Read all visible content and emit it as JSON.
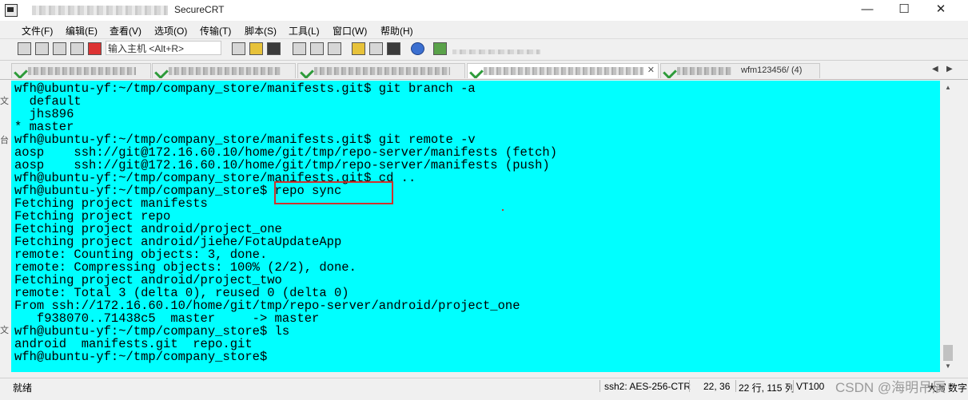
{
  "window": {
    "title": "SecureCRT",
    "controls": {
      "minimize": "—",
      "maximize": "☐",
      "close": "✕"
    }
  },
  "menu": [
    "文件(F)",
    "编辑(E)",
    "查看(V)",
    "选项(O)",
    "传输(T)",
    "脚本(S)",
    "工具(L)",
    "窗口(W)",
    "帮助(H)"
  ],
  "toolbar": {
    "host_input_placeholder": "输入主机 <Alt+R>"
  },
  "tabs": {
    "items": [
      {
        "label": "",
        "active": false
      },
      {
        "label": "",
        "active": false
      },
      {
        "label": "",
        "active": false
      },
      {
        "label": "",
        "active": true
      },
      {
        "label": "wfm123456/ (4)",
        "active": false
      }
    ],
    "nav_prev": "◀",
    "nav_next": "▶"
  },
  "left_fragments": [
    "文",
    "台",
    "文"
  ],
  "terminal": {
    "lines": [
      "wfh@ubuntu-yf:~/tmp/company_store/manifests.git$ git branch -a",
      "  default",
      "  jhs896",
      "* master",
      "wfh@ubuntu-yf:~/tmp/company_store/manifests.git$ git remote -v",
      "aosp    ssh://git@172.16.60.10/home/git/tmp/repo-server/manifests (fetch)",
      "aosp    ssh://git@172.16.60.10/home/git/tmp/repo-server/manifests (push)",
      "wfh@ubuntu-yf:~/tmp/company_store/manifests.git$ cd ..",
      "wfh@ubuntu-yf:~/tmp/company_store$ repo sync",
      "Fetching project manifests",
      "Fetching project repo",
      "Fetching project android/project_one",
      "Fetching project android/jiehe/FotaUpdateApp",
      "remote: Counting objects: 3, done.",
      "remote: Compressing objects: 100% (2/2), done.",
      "Fetching project android/project_two",
      "remote: Total 3 (delta 0), reused 0 (delta 0)",
      "From ssh://172.16.60.10/home/git/tmp/repo-server/android/project_one",
      "   f938070..71438c5  master     -> master",
      "wfh@ubuntu-yf:~/tmp/company_store$ ls",
      "android  manifests.git  repo.git",
      "wfh@ubuntu-yf:~/tmp/company_store$"
    ],
    "highlighted_command": "repo sync"
  },
  "status": {
    "ready": "就绪",
    "encryption": "ssh2: AES-256-CTR",
    "cursor": "22, 36",
    "size": "22 行, 115 列",
    "terminal_type": "VT100",
    "caps": "大写",
    "num": "数字"
  },
  "watermark": "CSDN @海明吊辰"
}
